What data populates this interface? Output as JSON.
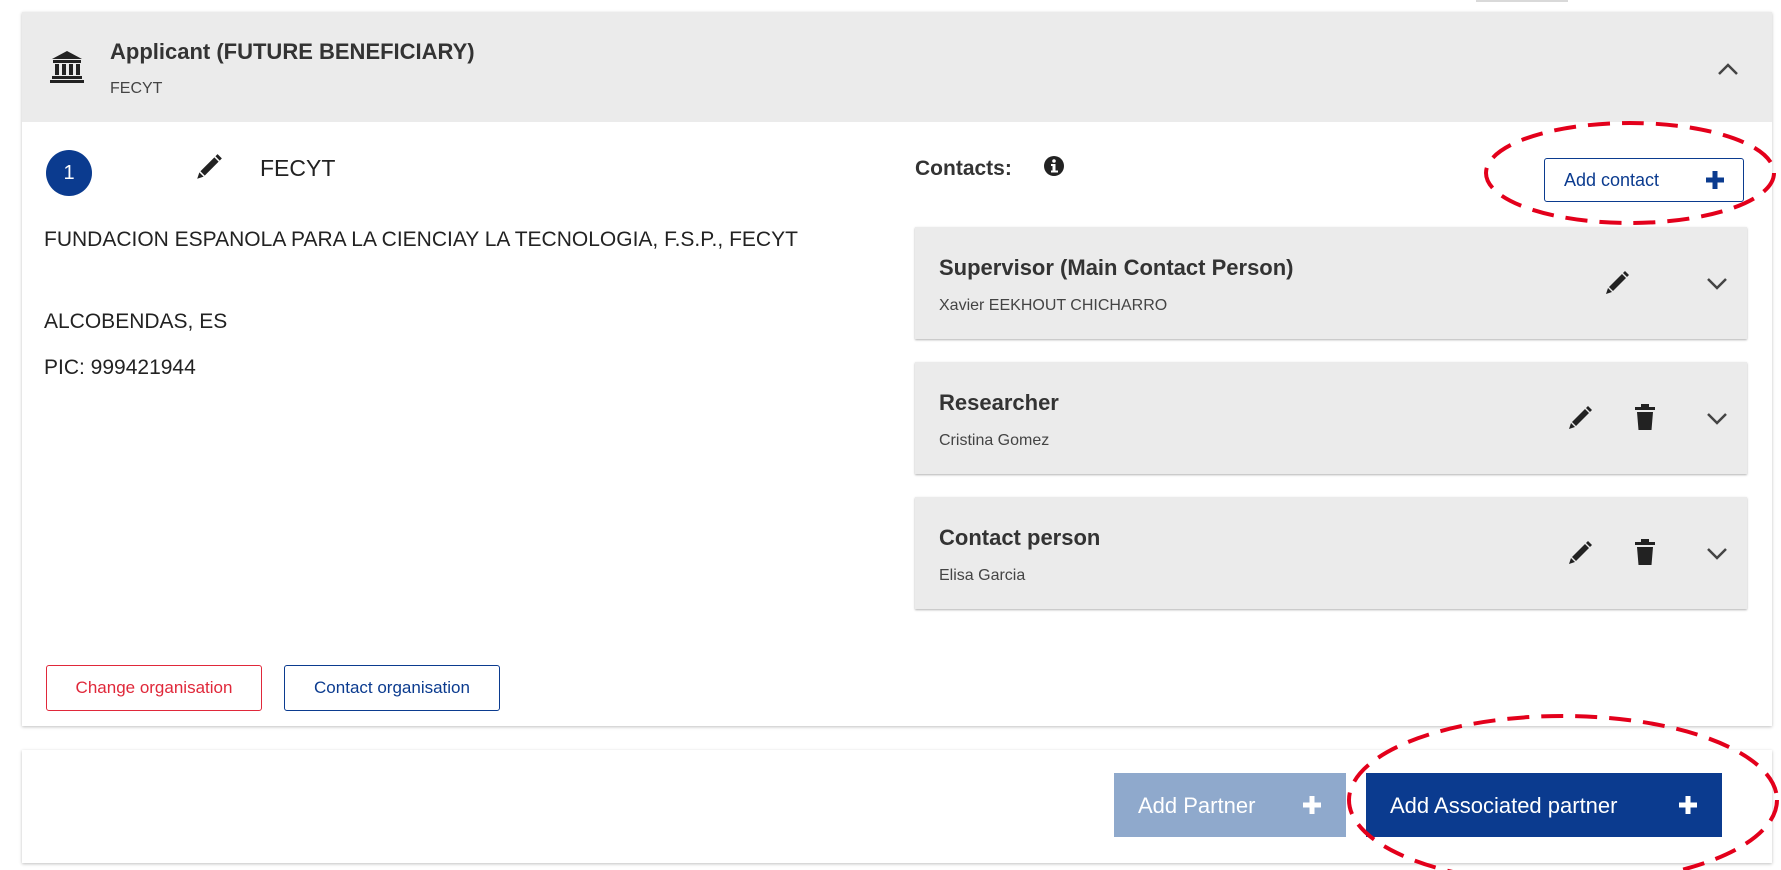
{
  "applicant_panel": {
    "title": "Applicant (FUTURE BENEFICIARY)",
    "subtitle": "FECYT"
  },
  "organisation": {
    "number": "1",
    "short_name": "FECYT",
    "full_name": "FUNDACION ESPANOLA PARA LA CIENCIAY LA TECNOLOGIA, F.S.P., FECYT",
    "location": "ALCOBENDAS, ES",
    "pic": "PIC: 999421944"
  },
  "contacts": {
    "label": "Contacts:",
    "add_button_label": "Add contact",
    "items": [
      {
        "role": "Supervisor (Main Contact Person)",
        "name": "Xavier EEKHOUT CHICHARRO",
        "deletable": false
      },
      {
        "role": "Researcher",
        "name": "Cristina Gomez",
        "deletable": true
      },
      {
        "role": "Contact person",
        "name": "Elisa Garcia",
        "deletable": true
      }
    ]
  },
  "actions": {
    "change_organisation": "Change organisation",
    "contact_organisation": "Contact organisation"
  },
  "footer": {
    "add_partner": "Add Partner",
    "add_associated_partner": "Add Associated partner"
  },
  "icons": {
    "header": "bank-icon",
    "collapse": "chevron-up-icon",
    "edit": "pencil-icon",
    "delete": "trash-icon",
    "expand": "chevron-down-icon",
    "info": "info-icon",
    "add": "plus-icon"
  },
  "colors": {
    "primary": "#0b3b8f",
    "danger": "#e0283a",
    "disabled_primary": "#8fa9cc",
    "header_bg": "#ebebeb",
    "annotation": "#e3001b"
  }
}
